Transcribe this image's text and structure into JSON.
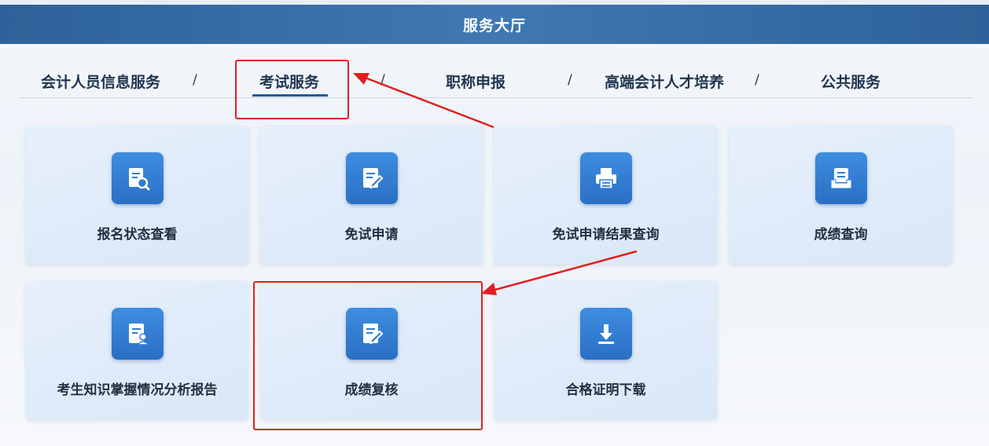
{
  "header": {
    "title": "服务大厅"
  },
  "tabs": [
    {
      "label": "会计人员信息服务"
    },
    {
      "label": "考试服务"
    },
    {
      "label": "职称申报"
    },
    {
      "label": "高端会计人才培养"
    },
    {
      "label": "公共服务"
    }
  ],
  "separator": "/",
  "active_tab": "考试服务",
  "cards": [
    {
      "label": "报名状态查看",
      "icon": "document-search-icon"
    },
    {
      "label": "免试申请",
      "icon": "document-edit-icon"
    },
    {
      "label": "免试申请结果查询",
      "icon": "printer-icon"
    },
    {
      "label": "成绩查询",
      "icon": "document-tray-icon"
    },
    {
      "label": "考生知识掌握情况分析报告",
      "icon": "document-user-icon"
    },
    {
      "label": "成绩复核",
      "icon": "document-edit-icon"
    },
    {
      "label": "合格证明下载",
      "icon": "download-icon"
    }
  ],
  "colors": {
    "header": "#2d6299",
    "icon_bg": "#2f7bd6",
    "highlight": "#e02020",
    "card_bg": "#dde9f8"
  }
}
